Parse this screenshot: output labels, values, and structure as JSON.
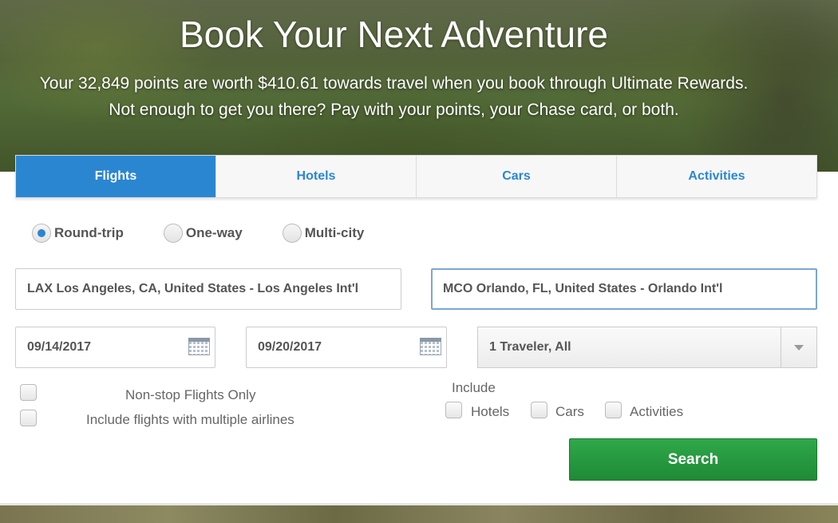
{
  "hero": {
    "title": "Book Your Next Adventure",
    "subtitle_line1": "Your 32,849 points are worth $410.61 towards travel when you book through Ultimate Rewards.",
    "subtitle_line2": "Not enough to get you there? Pay with your points, your Chase card, or both."
  },
  "tabs": [
    {
      "label": "Flights",
      "active": true
    },
    {
      "label": "Hotels",
      "active": false
    },
    {
      "label": "Cars",
      "active": false
    },
    {
      "label": "Activities",
      "active": false
    }
  ],
  "trip_type": {
    "options": [
      {
        "label": "Round-trip",
        "checked": true
      },
      {
        "label": "One-way",
        "checked": false
      },
      {
        "label": "Multi-city",
        "checked": false
      }
    ]
  },
  "search": {
    "origin": "LAX Los Angeles, CA, United States - Los Angeles Int'l",
    "destination": "MCO Orlando, FL, United States - Orlando Int'l",
    "depart_date": "09/14/2017",
    "return_date": "09/20/2017",
    "travelers": "1 Traveler, All"
  },
  "options": {
    "nonstop_label": "Non-stop Flights Only",
    "multi_airline_label": "Include flights with multiple airlines",
    "include_heading": "Include",
    "include_hotels": "Hotels",
    "include_cars": "Cars",
    "include_activities": "Activities"
  },
  "search_button": "Search",
  "colors": {
    "accent": "#2b86d2",
    "search_green": "#2a9c43",
    "text": "#555555"
  },
  "icons": [
    "calendar-icon",
    "chevron-down-icon"
  ]
}
